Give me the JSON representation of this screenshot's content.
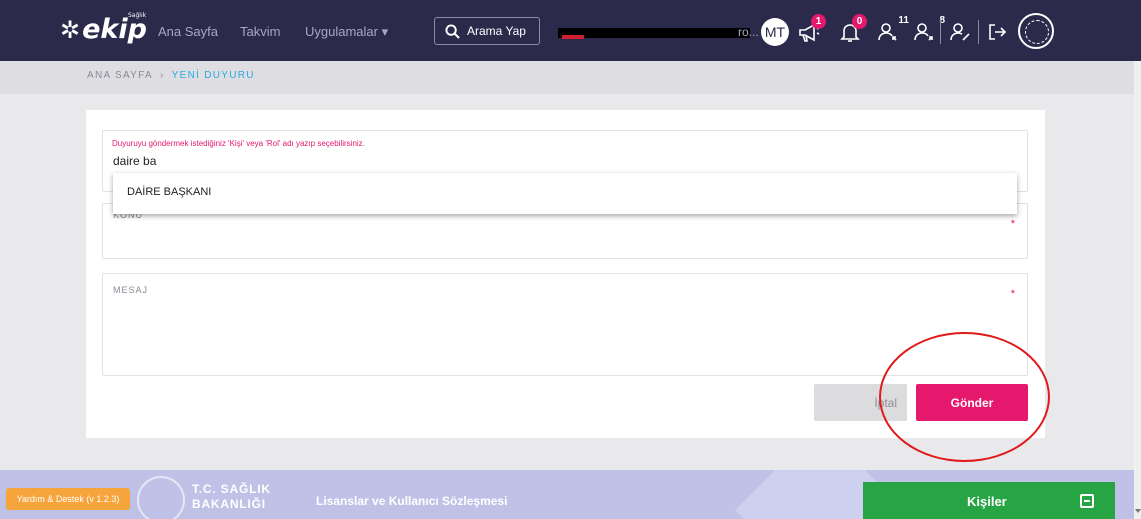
{
  "nav": {
    "logo": "ekip",
    "logo_sub": "Sağlık",
    "links": [
      "Ana Sayfa",
      "Takvim",
      "Uygulamalar"
    ],
    "search_label": "Arama Yap",
    "user_truncated": "ro...",
    "avatar": "MT",
    "badges": {
      "announcements": "1",
      "notifications": "0",
      "requests_in": "11",
      "requests_out": "8"
    }
  },
  "breadcrumb": {
    "home": "ANA SAYFA",
    "sep": "›",
    "current": "YENİ DUYURU"
  },
  "form": {
    "recipient_hint": "Duyuruyu göndermek istediğiniz 'Kişi' veya 'Rol' adı yazıp seçebilirsiniz.",
    "recipient_value": "daire ba",
    "suggestion": "DAİRE BAŞKANI",
    "subject_label": "KONU",
    "message_label": "MESAJ",
    "required_mark": "*",
    "cancel_label": "İptal",
    "submit_label": "Gönder"
  },
  "footer": {
    "help": "Yardım & Destek (v 1.2.3)",
    "org_line1": "T.C. SAĞLIK",
    "org_line2": "BAKANLIĞI",
    "license": "Lisanslar ve Kullanıcı Sözleşmesi",
    "contacts": "Kişiler"
  },
  "colors": {
    "navbar": "#2c2a4a",
    "accent": "#e6186d",
    "link": "#2aa9e0",
    "contacts": "#27a545",
    "help": "#f6a43c",
    "annotation": "#e0191b"
  }
}
